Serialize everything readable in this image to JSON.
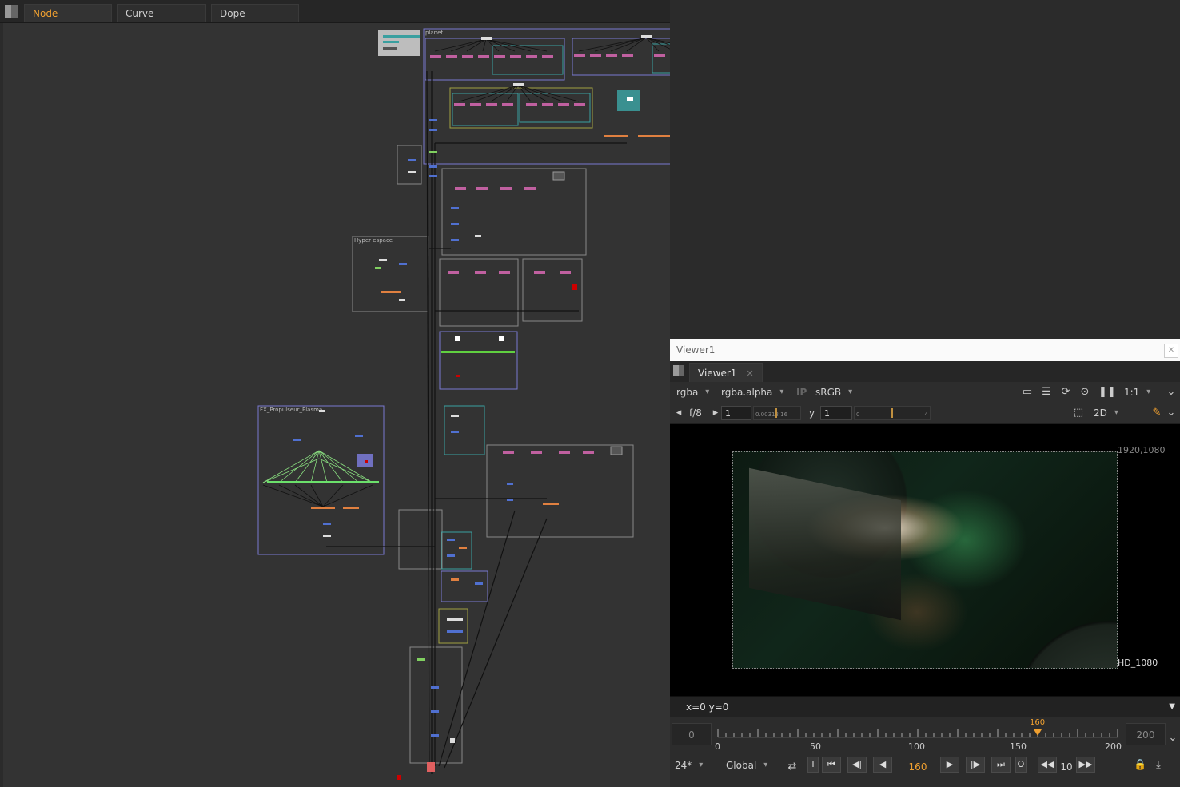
{
  "tabs": [
    {
      "label": "Node Graph",
      "active": true
    },
    {
      "label": "Curve Editor",
      "active": false
    },
    {
      "label": "Dope Sheet",
      "active": false
    }
  ],
  "graph": {
    "backdrops": {
      "planet": "planet",
      "hyper": "Hyper espace",
      "fx": "FX_Propulseur_Plasma"
    }
  },
  "viewer": {
    "window_title": "Viewer1",
    "tab_label": "Viewer1",
    "channels": "rgba",
    "alpha_channel": "rgba.alpha",
    "ip_label": "IP",
    "colorspace": "sRGB",
    "zoom": "1:1",
    "fstop": "f/8",
    "gain_value": "1",
    "gain_ticks": "0.00313 16",
    "gamma_label": "y",
    "gamma_value": "1",
    "gamma_ticks": "0",
    "gamma_tick_end": "4",
    "view_mode": "2D",
    "res_top": "1920,1080",
    "format": "HD_1080",
    "coords": "x=0 y=0",
    "timeline": {
      "start": "0",
      "end": "200",
      "current": "160",
      "ticks": [
        "0",
        "50",
        "100",
        "150",
        "200"
      ],
      "current_fraction": 0.8
    },
    "controls": {
      "fps": "24*",
      "scope": "Global",
      "in_label": "I",
      "out_label": "O",
      "frame": "160",
      "step": "10"
    }
  },
  "colors": {
    "active_tab": "#f0a030",
    "playhead": "#f0a030",
    "backdrop_blue": "#7a7ad0",
    "backdrop_teal": "#3aa0a0",
    "backdrop_yellow": "#a0a040"
  }
}
